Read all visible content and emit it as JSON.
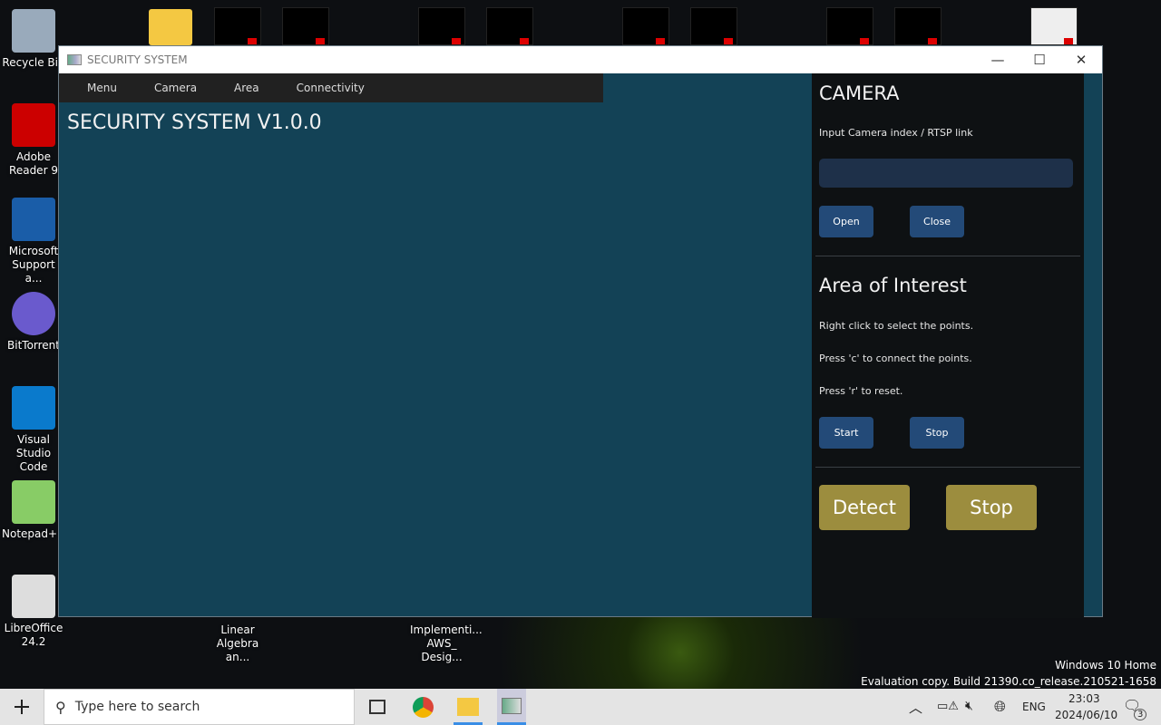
{
  "desktop": {
    "icons": [
      {
        "label": "Recycle Bin",
        "color": "#9ab"
      },
      {
        "label": "Adobe Reader 9",
        "color": "#c00"
      },
      {
        "label": "Microsoft Support a...",
        "color": "#1a5da8"
      },
      {
        "label": "BitTorrent",
        "color": "#6a5acd"
      },
      {
        "label": "Visual Studio Code",
        "color": "#0a7acc"
      },
      {
        "label": "Notepad++",
        "color": "#8c6"
      },
      {
        "label": "LibreOffice 24.2",
        "color": "#ddd"
      }
    ],
    "bottom_files": [
      "Linear Algebra an...",
      "Implementi... AWS_ Desig..."
    ],
    "watermark": [
      "Windows 10 Home",
      "Evaluation copy. Build 21390.co_release.210521-1658"
    ]
  },
  "window": {
    "title": "SECURITY SYSTEM",
    "controls": {
      "minimize": "—",
      "maximize": "☐",
      "close": "✕"
    },
    "menu": [
      "Menu",
      "Camera",
      "Area",
      "Connectivity"
    ],
    "app_title": "SECURITY SYSTEM V1.0.0",
    "camera": {
      "heading": "CAMERA",
      "label": "Input Camera index / RTSP link",
      "input_value": "",
      "open": "Open",
      "close": "Close"
    },
    "area": {
      "heading": "Area of Interest",
      "instructions": [
        "Right click to select the points.",
        "Press 'c' to connect the points.",
        "Press 'r' to reset."
      ],
      "start": "Start",
      "stop": "Stop"
    },
    "detect": {
      "detect": "Detect",
      "stop": "Stop"
    },
    "colors": {
      "main_bg": "#134256",
      "panel_bg": "#0e1113",
      "button": "#234a78",
      "accent_button": "#9c8d3e"
    }
  },
  "taskbar": {
    "search_placeholder": "Type here to search",
    "language": "ENG",
    "time": "23:03",
    "date": "2024/06/10",
    "notifications": "3"
  }
}
